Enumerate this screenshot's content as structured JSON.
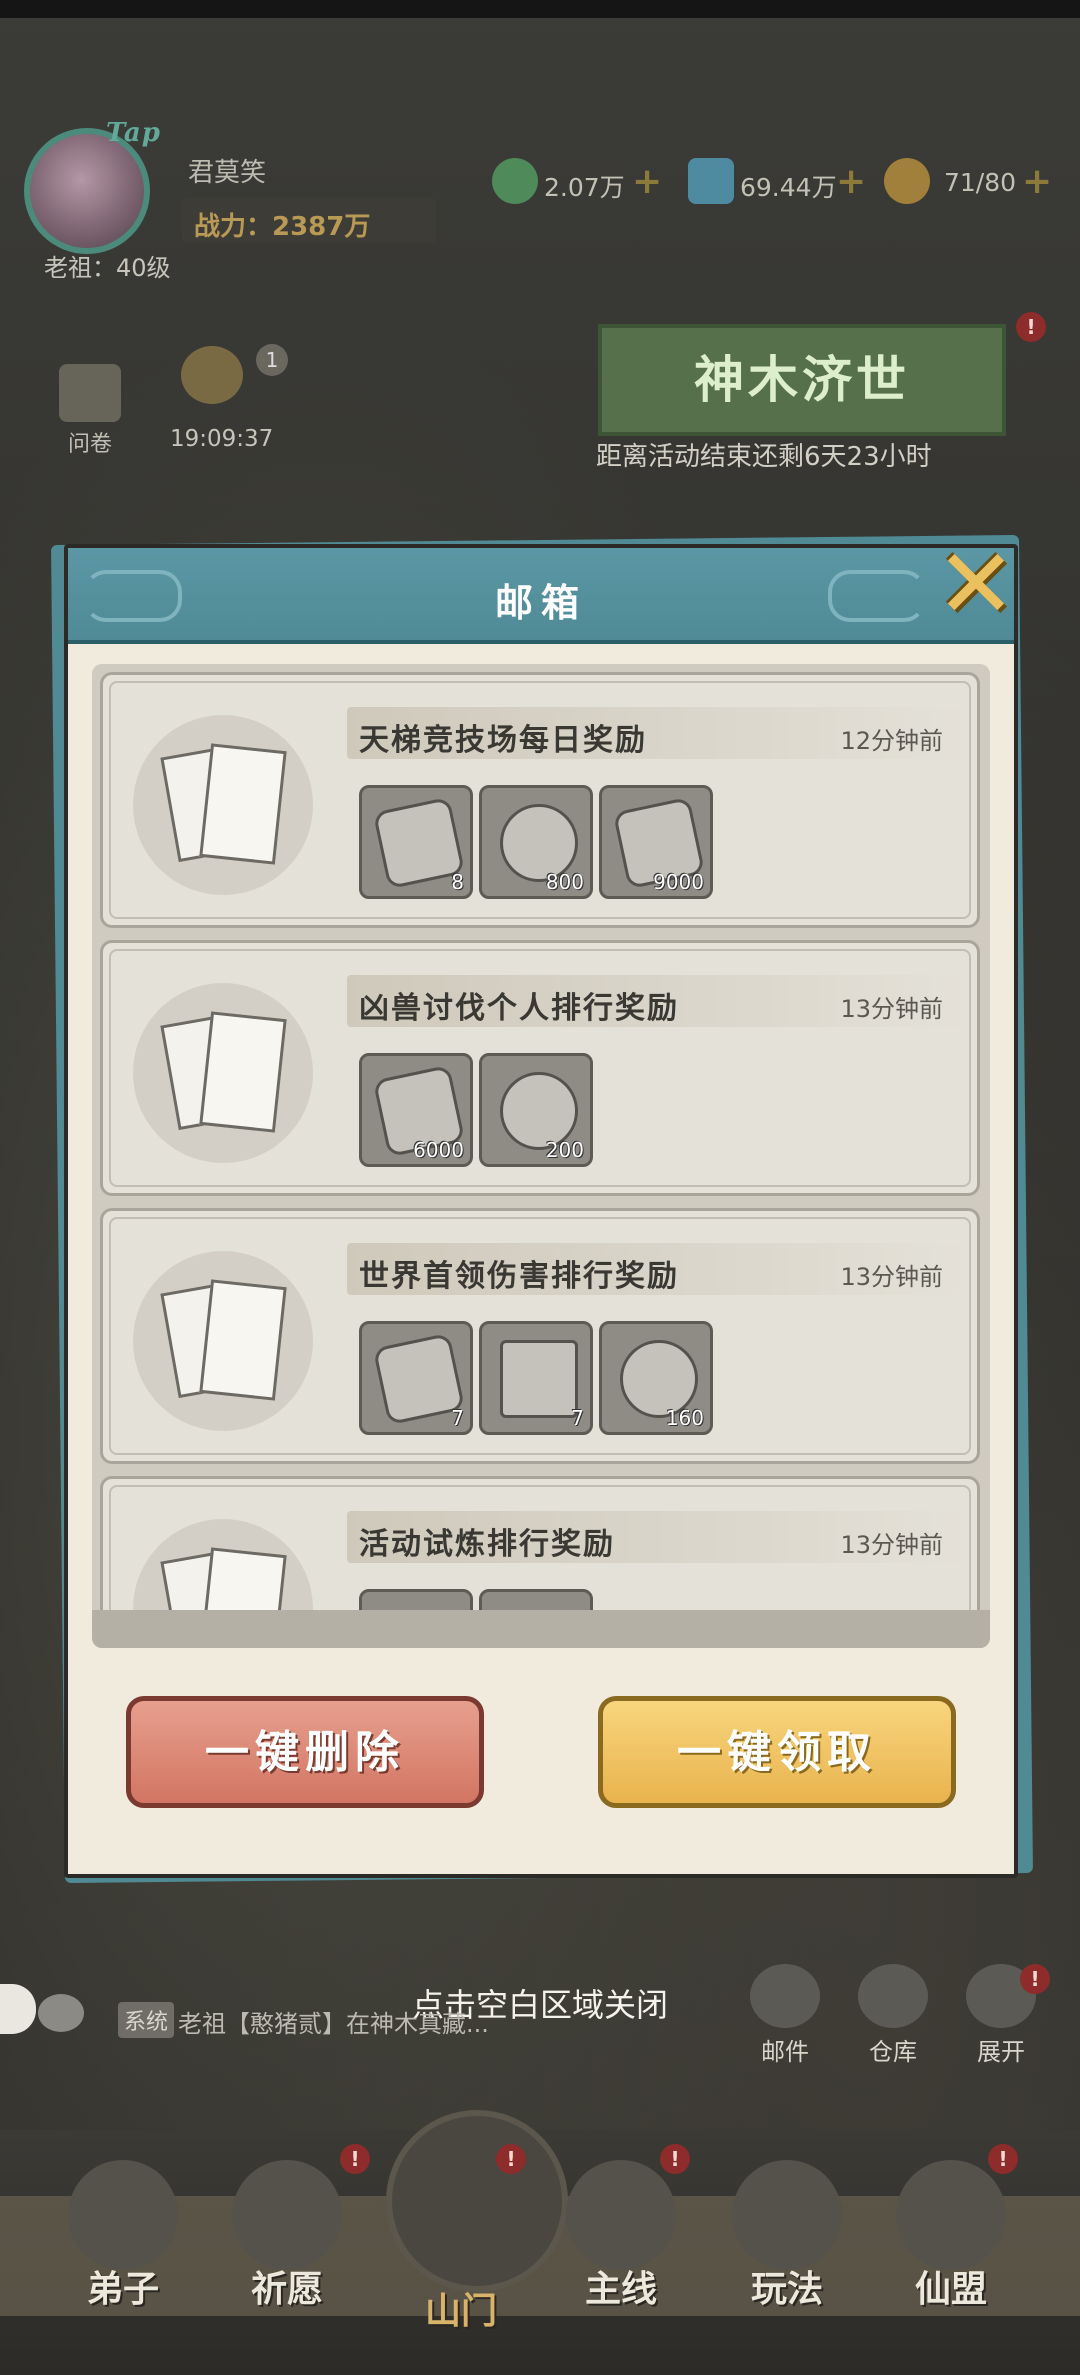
{
  "player": {
    "tap_badge": "Tap",
    "name": "君莫笑",
    "power_label": "战力：2387万",
    "level": "老祖：40级"
  },
  "resources": [
    {
      "icon": "jade-coin-icon",
      "value": "2.07万",
      "color": "#4e8a5a"
    },
    {
      "icon": "spirit-stone-icon",
      "value": "69.44万",
      "color": "#4e8aa0"
    },
    {
      "icon": "stamina-gourd-icon",
      "value": "71/80",
      "color": "#a0803a"
    }
  ],
  "resource_add_label": "+",
  "side": {
    "survey_label": "问卷",
    "timer_text": "19:09:37",
    "timer_badge": "1"
  },
  "event": {
    "title": "神木济世",
    "subtitle": "距离活动结束还剩6天23小时"
  },
  "mailbox": {
    "title": "邮箱",
    "close_label": "✕",
    "mails": [
      {
        "title": "天梯竞技场每日奖励",
        "time": "12分钟前",
        "rewards": [
          {
            "icon": "ticket-icon",
            "count": "8"
          },
          {
            "icon": "sword-medal-icon",
            "count": "800"
          },
          {
            "icon": "spirit-stone-icon",
            "count": "9000"
          }
        ]
      },
      {
        "title": "凶兽讨伐个人排行奖励",
        "time": "13分钟前",
        "rewards": [
          {
            "icon": "spirit-stone-icon",
            "count": "6000"
          },
          {
            "icon": "lotus-coin-icon",
            "count": "200"
          }
        ]
      },
      {
        "title": "世界首领伤害排行奖励",
        "time": "13分钟前",
        "rewards": [
          {
            "icon": "scroll-token-icon",
            "count": "7"
          },
          {
            "icon": "treasure-chest-icon",
            "count": "7"
          },
          {
            "icon": "ore-icon",
            "count": "160"
          }
        ]
      },
      {
        "title": "活动试炼排行奖励",
        "time": "13分钟前",
        "rewards": []
      }
    ],
    "delete_all_label": "一键删除",
    "claim_all_label": "一键领取"
  },
  "close_hint": "点击空白区域关闭",
  "chat": {
    "channel": "系统",
    "message": "老祖【憨猪贰】在神木真藏..."
  },
  "quick_menu": [
    {
      "label": "邮件"
    },
    {
      "label": "仓库"
    },
    {
      "label": "展开"
    }
  ],
  "nav": [
    {
      "label": "弟子"
    },
    {
      "label": "祈愿"
    },
    {
      "label": "山门",
      "active": true
    },
    {
      "label": "主线"
    },
    {
      "label": "玩法"
    },
    {
      "label": "仙盟"
    }
  ]
}
